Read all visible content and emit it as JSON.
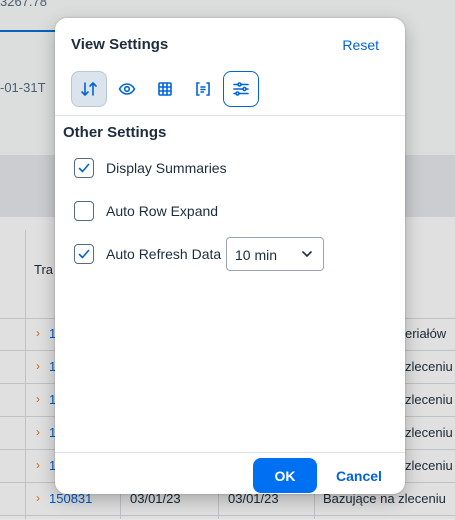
{
  "background": {
    "chart_value": "3267.78",
    "chart_date": "-01-31T",
    "column_header": "Tra",
    "rows": [
      {
        "id": "1",
        "right": "eriałów"
      },
      {
        "id": "1",
        "right": "zleceniu"
      },
      {
        "id": "1",
        "right": "zleceniu"
      },
      {
        "id": "1",
        "right": "zleceniu"
      },
      {
        "id": "1",
        "right": "zleceniu"
      }
    ],
    "last_row": {
      "id": "150831",
      "date1": "03/01/23",
      "date2": "03/01/23",
      "description": "Bazujące na zleceniu"
    },
    "row_arrow": "›"
  },
  "dialog": {
    "title": "View Settings",
    "reset_label": "Reset",
    "tabs": [
      {
        "icon": "sort-icon"
      },
      {
        "icon": "eye-icon"
      },
      {
        "icon": "table-icon"
      },
      {
        "icon": "group-icon"
      },
      {
        "icon": "settings-sliders-icon",
        "active": true
      }
    ],
    "section_title": "Other Settings",
    "options": [
      {
        "label": "Display Summaries",
        "checked": true
      },
      {
        "label": "Auto Row Expand",
        "checked": false
      },
      {
        "label": "Auto Refresh Data",
        "checked": true
      }
    ],
    "refresh_select": {
      "value": "10 min"
    },
    "ok_label": "OK",
    "cancel_label": "Cancel"
  },
  "colors": {
    "accent": "#0064d9",
    "primary_button": "#0070f2",
    "text": "#1d2d3e",
    "arrow": "#e9730c"
  }
}
